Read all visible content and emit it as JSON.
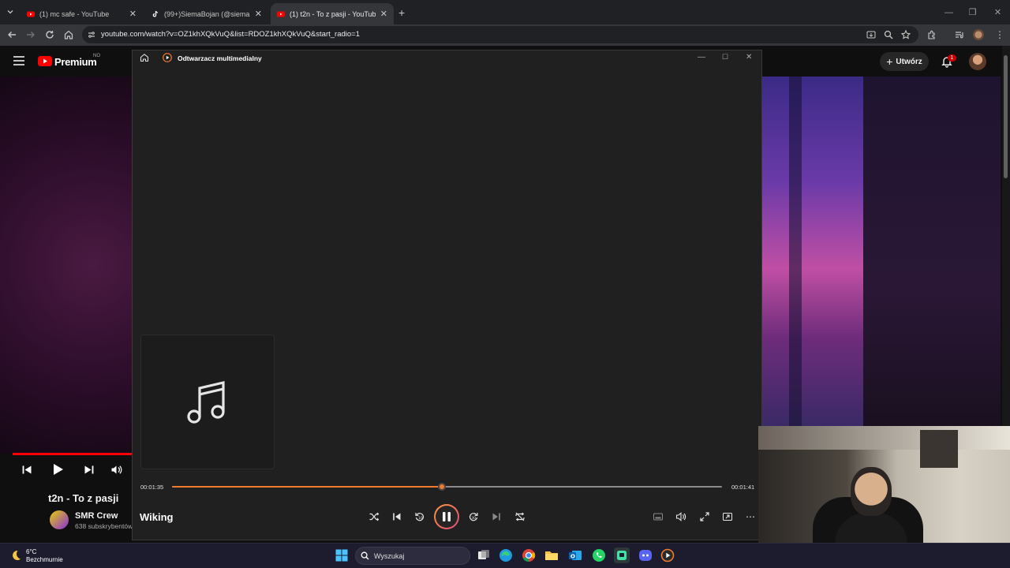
{
  "browser": {
    "tabs": [
      {
        "title": "(1) mc safe - YouTube",
        "active": false
      },
      {
        "title": "(99+)SiemaBojan (@siemabojan",
        "active": false
      },
      {
        "title": "(1) t2n - To z pasji - YouTube",
        "active": true
      }
    ],
    "url": "youtube.com/watch?v=OZ1khXQkVuQ&list=RDOZ1khXQkVuQ&start_radio=1",
    "accent": "#202124"
  },
  "youtube": {
    "logo": "Premium",
    "logo_region": "NO",
    "create_label": "Utwórz",
    "notification_count": "1",
    "video_title": "t2n - To z pasji",
    "channel_name": "SMR Crew",
    "subscribers": "638 subskrybentów"
  },
  "player": {
    "window_title": "Odtwarzacz multimedialny",
    "track_name": "Wiking",
    "time_current": "00:01:35",
    "time_total": "00:01:41",
    "progress": 0.49,
    "accent": "#f07a2e"
  },
  "taskbar": {
    "weather_temp": "6°C",
    "weather_desc": "Bezchmurnie",
    "search_placeholder": "Wyszukaj"
  }
}
